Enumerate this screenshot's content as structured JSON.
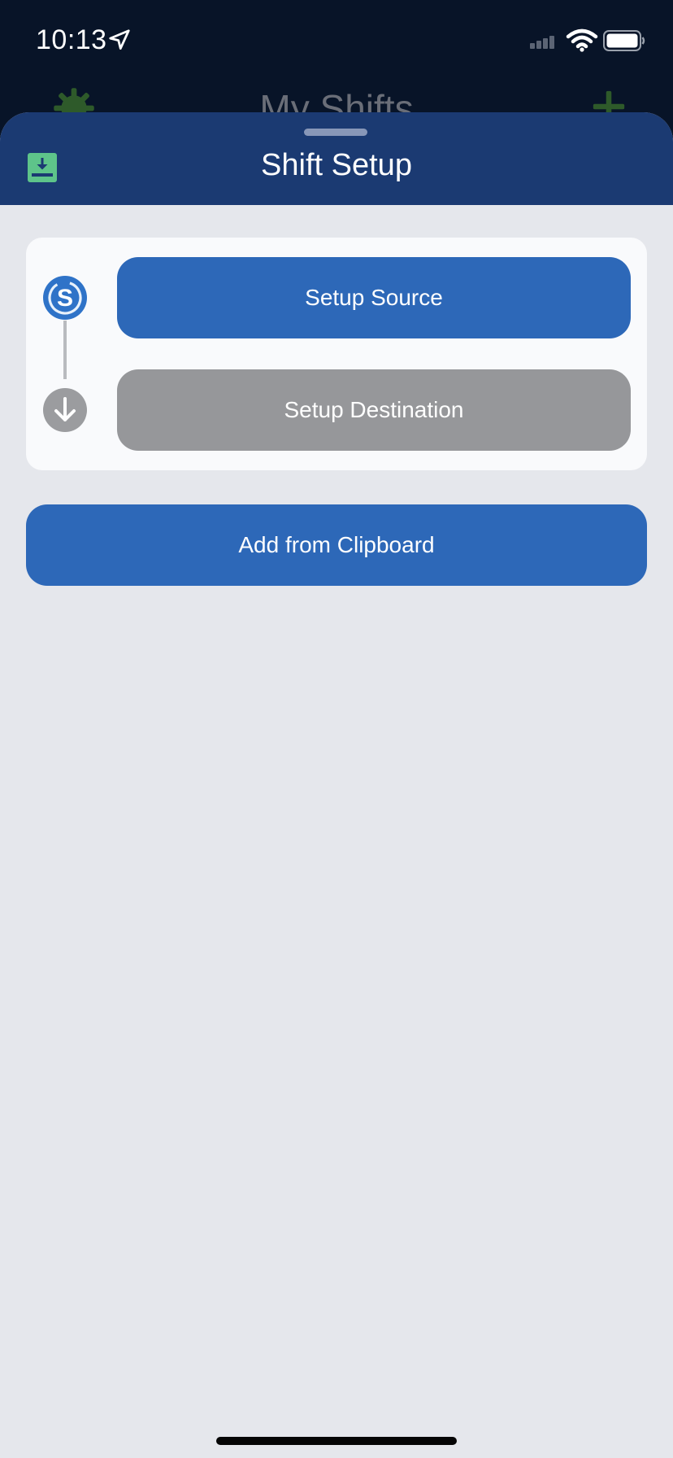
{
  "status_bar": {
    "time": "10:13",
    "icons": [
      "location-arrow-icon",
      "cellular-signal-icon",
      "wifi-icon",
      "battery-icon"
    ]
  },
  "background_screen": {
    "title": "My Shifts",
    "icons": [
      "gear-icon",
      "plus-icon"
    ]
  },
  "sheet": {
    "title": "Shift Setup",
    "header_icon": "download-icon",
    "steps": [
      {
        "label": "Setup Source",
        "icon": "shift-source-icon",
        "active": true
      },
      {
        "label": "Setup Destination",
        "icon": "arrow-down-icon",
        "active": false
      }
    ],
    "clipboard_button": "Add from Clipboard"
  },
  "colors": {
    "header_bg": "#1b3a72",
    "status_bg": "#081428",
    "sheet_bg": "#e5e7ec",
    "primary_button": "#2d68b8",
    "disabled_button": "#96979a",
    "download_icon": "#5ec48a",
    "gear_icon": "#2e5a2a"
  }
}
